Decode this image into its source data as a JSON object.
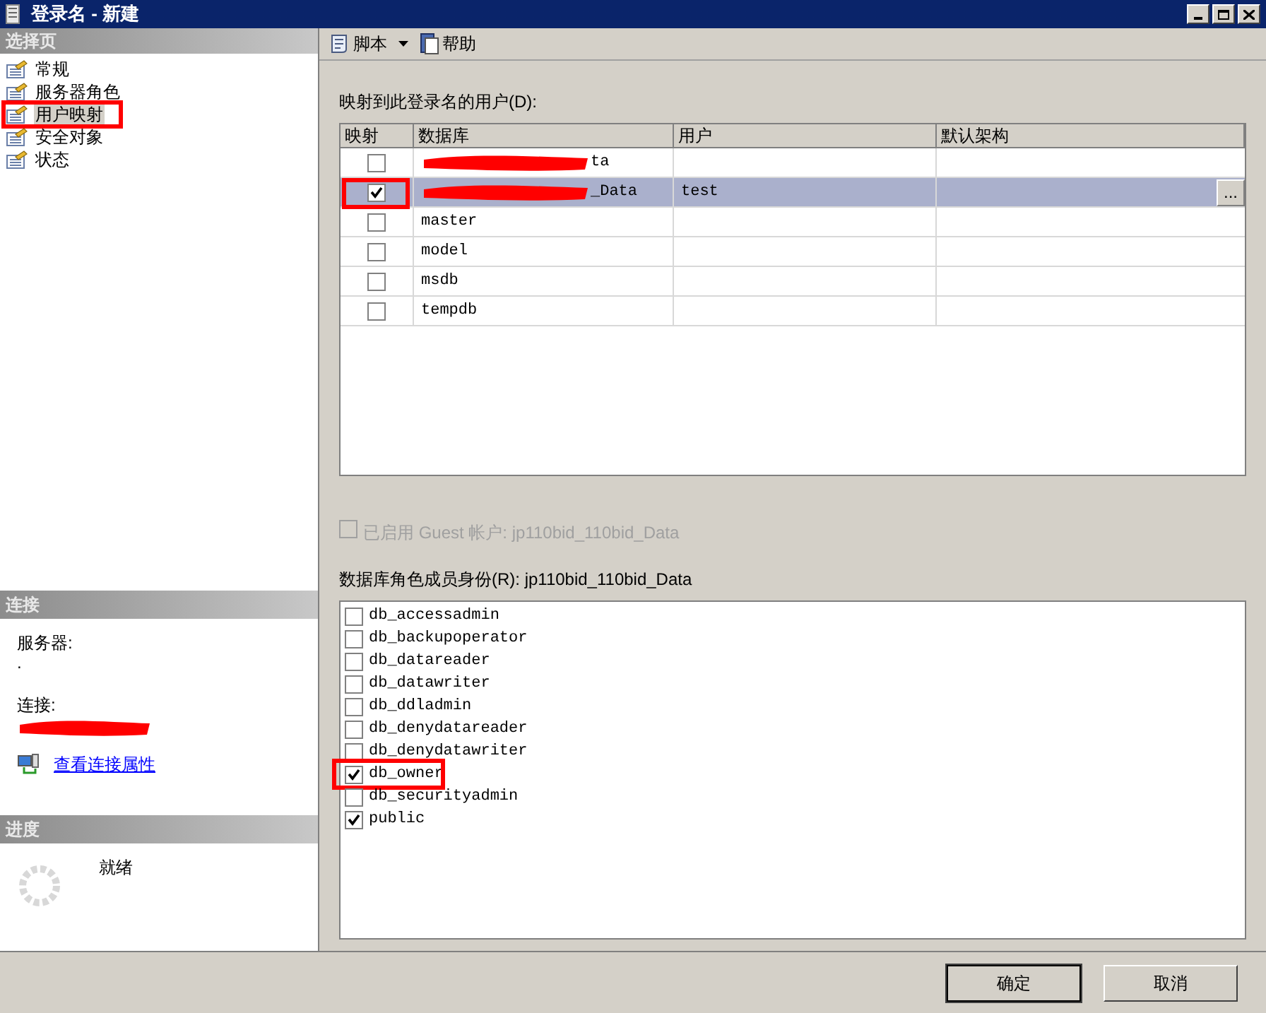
{
  "window": {
    "title": "登录名 - 新建"
  },
  "sidebar": {
    "heading": "选择页",
    "items": [
      {
        "label": "常规",
        "selected": false,
        "annotated": false
      },
      {
        "label": "服务器角色",
        "selected": false,
        "annotated": false
      },
      {
        "label": "用户映射",
        "selected": true,
        "annotated": true
      },
      {
        "label": "安全对象",
        "selected": false,
        "annotated": false
      },
      {
        "label": "状态",
        "selected": false,
        "annotated": false
      }
    ]
  },
  "connection": {
    "heading": "连接",
    "server_label": "服务器:",
    "server_value": ".",
    "connection_label": "连接:",
    "connection_redacted": true,
    "link": "查看连接属性"
  },
  "progress": {
    "heading": "进度",
    "status": "就绪"
  },
  "toolbar": [
    {
      "label": "脚本",
      "kind": "dropdown"
    },
    {
      "label": "帮助",
      "kind": "help"
    }
  ],
  "users": {
    "label": "映射到此登录名的用户(D):",
    "columns": [
      "映射",
      "数据库",
      "用户",
      "默认架构"
    ],
    "rows": [
      {
        "mapped": false,
        "database": "ta",
        "redacted": true,
        "selected": false,
        "annotated": false
      },
      {
        "mapped": true,
        "database": "_Data",
        "redacted": true,
        "user": "test",
        "browse": "...",
        "selected": true,
        "annotated": true
      },
      {
        "mapped": false,
        "database": "master",
        "redacted": false,
        "selected": false,
        "annotated": false
      },
      {
        "mapped": false,
        "database": "model",
        "redacted": false,
        "selected": false,
        "annotated": false
      },
      {
        "mapped": false,
        "database": "msdb",
        "redacted": false,
        "selected": false,
        "annotated": false
      },
      {
        "mapped": false,
        "database": "tempdb",
        "redacted": false,
        "selected": false,
        "annotated": false
      }
    ]
  },
  "guest": {
    "label": "已启用 Guest 帐户: jp110bid_110bid_Data",
    "checked": false,
    "disabled": true
  },
  "roles": {
    "label": "数据库角色成员身份(R): jp110bid_110bid_Data",
    "items": [
      {
        "name": "db_accessadmin",
        "checked": false,
        "annotated": false
      },
      {
        "name": "db_backupoperator",
        "checked": false,
        "annotated": false
      },
      {
        "name": "db_datareader",
        "checked": false,
        "annotated": false
      },
      {
        "name": "db_datawriter",
        "checked": false,
        "annotated": false
      },
      {
        "name": "db_ddladmin",
        "checked": false,
        "annotated": false
      },
      {
        "name": "db_denydatareader",
        "checked": false,
        "annotated": false
      },
      {
        "name": "db_denydatawriter",
        "checked": false,
        "annotated": false
      },
      {
        "name": "db_owner",
        "checked": true,
        "annotated": true
      },
      {
        "name": "db_securityadmin",
        "checked": false,
        "annotated": false
      },
      {
        "name": "public",
        "checked": true,
        "annotated": false
      }
    ]
  },
  "buttons": [
    {
      "label": "确定",
      "default": true
    },
    {
      "label": "取消",
      "default": false
    }
  ]
}
